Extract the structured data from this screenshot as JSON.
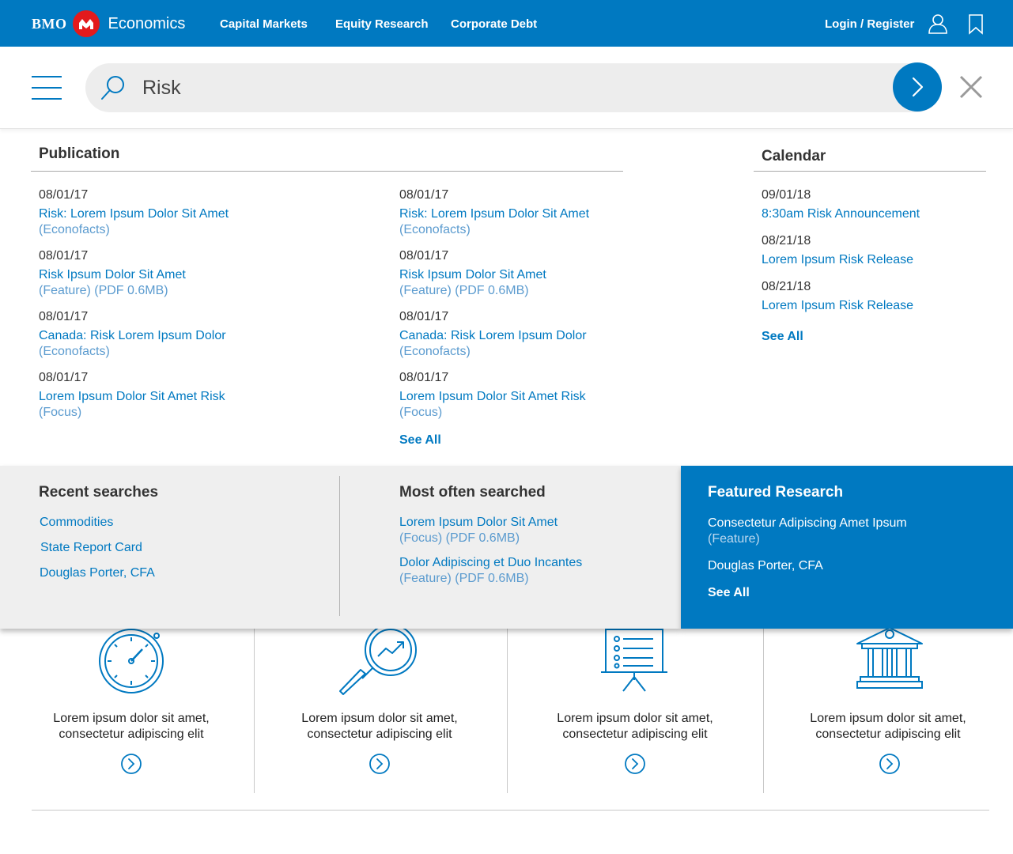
{
  "header": {
    "brand_bmo": "BMO",
    "brand_title": "Economics",
    "nav": [
      "Capital Markets",
      "Equity Research",
      "Corporate Debt"
    ],
    "login": "Login / Register",
    "icons": [
      "bmo-roundel-icon",
      "user-icon",
      "bookmark-icon"
    ]
  },
  "search": {
    "value": "Risk",
    "icons": [
      "menu-icon",
      "search-icon",
      "arrow-right-icon",
      "close-icon"
    ]
  },
  "publication": {
    "title": "Publication",
    "columns": [
      [
        {
          "date": "08/01/17",
          "title": "Risk: Lorem Ipsum Dolor Sit Amet",
          "meta": "(Econofacts)"
        },
        {
          "date": "08/01/17",
          "title": "Risk Ipsum Dolor Sit Amet",
          "meta": "(Feature) (PDF 0.6MB)"
        },
        {
          "date": "08/01/17",
          "title": "Canada: Risk Lorem Ipsum Dolor",
          "meta": "(Econofacts)"
        },
        {
          "date": "08/01/17",
          "title": "Lorem Ipsum Dolor Sit Amet Risk",
          "meta": "(Focus)"
        }
      ],
      [
        {
          "date": "08/01/17",
          "title": "Risk: Lorem Ipsum Dolor Sit Amet",
          "meta": "(Econofacts)"
        },
        {
          "date": "08/01/17",
          "title": "Risk Ipsum Dolor Sit Amet",
          "meta": "(Feature) (PDF 0.6MB)"
        },
        {
          "date": "08/01/17",
          "title": "Canada: Risk Lorem Ipsum Dolor",
          "meta": "(Econofacts)"
        },
        {
          "date": "08/01/17",
          "title": "Lorem Ipsum Dolor Sit Amet Risk",
          "meta": "(Focus)"
        }
      ]
    ],
    "see_all": "See All"
  },
  "calendar": {
    "title": "Calendar",
    "items": [
      {
        "date": "09/01/18",
        "title": "8:30am Risk Announcement"
      },
      {
        "date": "08/21/18",
        "title": "Lorem Ipsum Risk Release"
      },
      {
        "date": "08/21/18",
        "title": "Lorem Ipsum Risk Release"
      }
    ],
    "see_all": "See All"
  },
  "recent": {
    "title": "Recent searches",
    "items": [
      "Commodities",
      "State Report Card",
      "Douglas Porter, CFA"
    ]
  },
  "most_often": {
    "title": "Most often searched",
    "items": [
      {
        "title": "Lorem Ipsum Dolor Sit Amet",
        "meta": "(Focus) (PDF 0.6MB)"
      },
      {
        "title": "Dolor Adipiscing et Duo Incantes",
        "meta": "(Feature) (PDF 0.6MB)"
      }
    ]
  },
  "featured": {
    "title": "Featured Research",
    "item_title": "Consectetur Adipiscing Amet Ipsum",
    "item_meta": "(Feature)",
    "author": "Douglas Porter, CFA",
    "see_all": "See All"
  },
  "tiles": [
    {
      "icon": "stopwatch-icon",
      "line1": "Lorem ipsum dolor sit amet,",
      "line2": "consectetur adipiscing elit"
    },
    {
      "icon": "magnifier-chart-icon",
      "line1": "Lorem ipsum dolor sit amet,",
      "line2": "consectetur adipiscing elit"
    },
    {
      "icon": "presentation-board-icon",
      "line1": "Lorem ipsum dolor sit amet,",
      "line2": "consectetur adipiscing elit"
    },
    {
      "icon": "bank-building-icon",
      "line1": "Lorem ipsum dolor sit amet,",
      "line2": "consectetur adipiscing elit"
    }
  ],
  "colors": {
    "brand_blue": "#0079c1",
    "brand_red": "#e31a1c",
    "panel_grey": "#efefef"
  }
}
